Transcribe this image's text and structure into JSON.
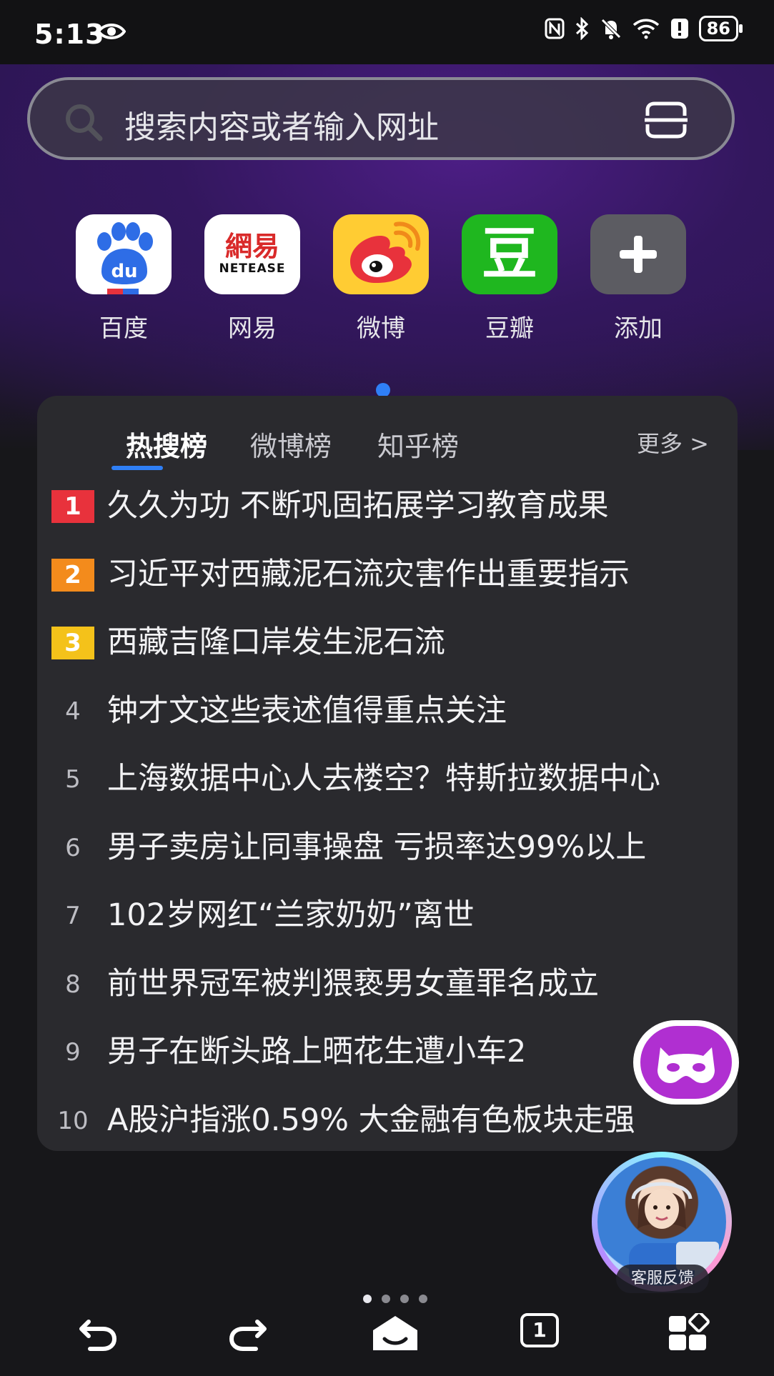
{
  "status_bar": {
    "time": "5:13",
    "battery": "86",
    "icons": [
      "eye-icon",
      "nfc-icon",
      "bluetooth-icon",
      "mute-icon",
      "wifi-icon",
      "alert-icon",
      "battery-icon"
    ]
  },
  "search": {
    "placeholder": "搜索内容或者输入网址",
    "icons": [
      "search-icon",
      "scan-icon"
    ]
  },
  "shortcuts": [
    {
      "label": "百度",
      "icon": "baidu-icon",
      "color": "#ffffff"
    },
    {
      "label": "网易",
      "icon": "netease-icon",
      "color": "#ffffff",
      "logo_text": "網易",
      "logo_sub": "NETEASE"
    },
    {
      "label": "微博",
      "icon": "weibo-icon",
      "color": "#ffcc33"
    },
    {
      "label": "豆瓣",
      "icon": "douban-icon",
      "color": "#1fb71f",
      "logo_text": "豆"
    },
    {
      "label": "添加",
      "icon": "plus-icon",
      "color": "#5c5c62"
    }
  ],
  "hot": {
    "tabs": [
      "热搜榜",
      "微博榜",
      "知乎榜"
    ],
    "active_tab": "热搜榜",
    "more": "更多 >",
    "items": [
      {
        "rank": "1",
        "title": "久久为功 不断巩固拓展学习教育成果",
        "badge_color": "#e8323c"
      },
      {
        "rank": "2",
        "title": "习近平对西藏泥石流灾害作出重要指示",
        "badge_color": "#f38b1c"
      },
      {
        "rank": "3",
        "title": "西藏吉隆口岸发生泥石流",
        "badge_color": "#f4c21a"
      },
      {
        "rank": "4",
        "title": "钟才文这些表述值得重点关注"
      },
      {
        "rank": "5",
        "title": "上海数据中心人去楼空？特斯拉数据中心"
      },
      {
        "rank": "6",
        "title": "男子卖房让同事操盘 亏损率达99%以上"
      },
      {
        "rank": "7",
        "title": "102岁网红“兰家奶奶”离世"
      },
      {
        "rank": "8",
        "title": "前世界冠军被判猥亵男女童罪名成立"
      },
      {
        "rank": "9",
        "title": "男子在断头路上晒花生遭小车2"
      },
      {
        "rank": "10",
        "title": "A股沪指涨0.59% 大金融有色板块走强"
      }
    ]
  },
  "floating": {
    "mask_icon": "mask-icon",
    "service_label": "客服反馈"
  },
  "bottom_nav": {
    "tab_count": "1",
    "icons": [
      "back-icon",
      "forward-icon",
      "home-icon",
      "tabs-icon",
      "menu-grid-icon"
    ]
  },
  "colors": {
    "accent": "#2f7ff6",
    "background": "#17171a",
    "card": "#2a2a2e"
  }
}
